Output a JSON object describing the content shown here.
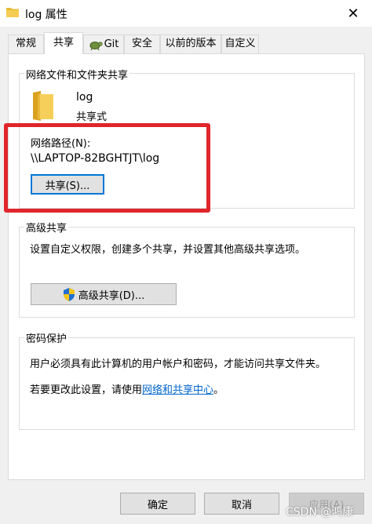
{
  "window": {
    "title": "log 属性",
    "close_glyph": "✕"
  },
  "tabs": [
    {
      "label": "常规"
    },
    {
      "label": "共享"
    },
    {
      "label": "Git"
    },
    {
      "label": "安全"
    },
    {
      "label": "以前的版本"
    },
    {
      "label": "自定义"
    }
  ],
  "network_sharing": {
    "group_title": "网络文件和文件夹共享",
    "folder_name": "log",
    "share_status": "共享式",
    "path_label": "网络路径(N):",
    "path_value": "\\\\LAPTOP-82BGHTJT\\log",
    "share_button": "共享(S)..."
  },
  "advanced_sharing": {
    "group_title": "高级共享",
    "description": "设置自定义权限，创建多个共享，并设置其他高级共享选项。",
    "button": "高级共享(D)..."
  },
  "password_protection": {
    "group_title": "密码保护",
    "description": "用户必须具有此计算机的用户帐户和密码，才能访问共享文件夹。",
    "change_prefix": "若要更改此设置，请使用",
    "link_text": "网络和共享中心",
    "change_suffix": "。"
  },
  "footer": {
    "ok": "确定",
    "cancel": "取消",
    "apply": "应用(A)"
  },
  "watermark": "CSDN @鸿康",
  "colors": {
    "accent": "#0078d7",
    "highlight": "#e0262b",
    "link": "#0066cc"
  }
}
